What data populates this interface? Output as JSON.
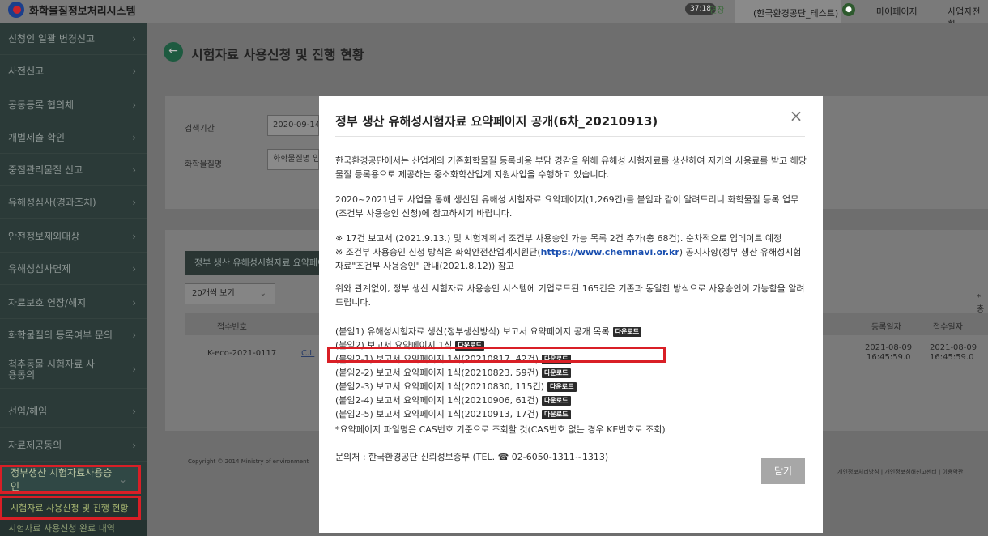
{
  "header": {
    "logo_text": "화학물질정보처리시스템",
    "timer": "37:18",
    "extend_label": "연장",
    "user_name": "(한국환경공단_테스트)",
    "mypage": "마이페이지",
    "company_link": "사업자전환"
  },
  "sidebar": {
    "items": [
      {
        "label": "신청인 일괄 변경신고"
      },
      {
        "label": "사전신고"
      },
      {
        "label": "공동등록 협의체"
      },
      {
        "label": "개별제출 확인"
      },
      {
        "label": "중점관리물질 신고"
      },
      {
        "label": "유해성심사(경과조치)"
      },
      {
        "label": "안전정보제외대상"
      },
      {
        "label": "유해성심사면제"
      },
      {
        "label": "자료보호 연장/해지"
      },
      {
        "label": "화학물질의 등록여부 문의"
      },
      {
        "label": "척추동물 시험자료 사용동의"
      },
      {
        "label": "선임/해임"
      },
      {
        "label": "자료제공동의"
      },
      {
        "label": "정부생산 시험자료사용승인"
      }
    ],
    "sub_items": [
      {
        "label": "시험자료 사용신청 및 진행 현황"
      },
      {
        "label": "시험자료 사용신청 완료 내역"
      }
    ],
    "toggle_icon": "‹"
  },
  "main": {
    "page_title": "시험자료 사용신청 및 진행 현황",
    "back_icon": "←",
    "search": {
      "period_label": "검색기간",
      "period_value": "2020-09-14",
      "chem_label": "화학물질명",
      "chem_placeholder": "화학물질명 입력"
    },
    "tab_label": "정부 생산 유해성시험자료 요약페이지 공개",
    "page_size": "20개씩 보기",
    "total_mark": "* 총",
    "table": {
      "headers": [
        "접수번호",
        "등록일자",
        "접수일자"
      ],
      "row": {
        "receipt_no": "K-eco-2021-0117",
        "link_text": "C.I.",
        "reg_date": "2021-08-09",
        "reg_time": "16:45:59.0",
        "rcpt_date": "2021-08-09",
        "rcpt_time": "16:45:59.0"
      }
    },
    "footer_copy": "Copyright © 2014 Ministry of environment",
    "footer_links": "개인정보처리방침 | 개인정보침해신고센터 | 이용약관"
  },
  "modal": {
    "title": "정부 생산 유해성시험자료 요약페이지 공개(6차_20210913)",
    "close_icon": "×",
    "para1": "한국환경공단에서는 산업계의 기존화학물질 등록비용 부담 경감을 위해 유해성 시험자료를 생산하여 저가의 사용료를 받고 해당 물질 등록용으로 제공하는 중소화학산업계 지원사업을 수행하고 있습니다.",
    "para2": "2020~2021년도 사업을 통해 생산된 유해성 시험자료 요약페이지(1,269건)를 붙임과 같이 알려드리니 화학물질 등록 업무(조건부 사용승인 신청)에 참고하시기 바랍니다.",
    "para3_line1": "※ 17건 보고서 (2021.9.13.) 및 시험계획서 조건부 사용승인 가능 목록 2건 추가(총 68건). 순차적으로 업데이트 예정",
    "para3_line2_pre": "※ 조건부 사용승인 신청 방식은 화학안전산업계지원단(",
    "para3_url": "https://www.chemnavi.or.kr",
    "para3_line2_post": ") 공지사항(정부 생산 유해성시험자료\"조건부 사용승인\" 안내(2021.8.12)) 참고",
    "para4": "위와 관계없이, 정부 생산 시험자료 사용승인 시스템에 기업로드된 165건은 기존과 동일한 방식으로 사용승인이 가능함을 알려드립니다.",
    "download_label": "다운로드",
    "attachments": [
      {
        "label": "(붙임1) 유해성시험자료 생산(정부생산방식) 보고서 요약페이지 공개 목록"
      },
      {
        "label": "(붙임2) 보고서 요약페이지 1식"
      },
      {
        "label": "(붙임2-1) 보고서 요약페이지 1식(20210817, 42건)"
      },
      {
        "label": "(붙임2-2) 보고서 요약페이지 1식(20210823, 59건)"
      },
      {
        "label": "(붙임2-3) 보고서 요약페이지 1식(20210830, 115건)"
      },
      {
        "label": "(붙임2-4) 보고서 요약페이지 1식(20210906, 61건)"
      },
      {
        "label": "(붙임2-5) 보고서 요약페이지 1식(20210913, 17건)"
      }
    ],
    "cas_note": "*요약페이지 파일명은 CAS번호 기준으로 조회할 것(CAS번호 없는 경우 KE번호로 조회)",
    "contact": "문의처 : 한국환경공단 신뢰성보증부 (TEL. ☎ 02-6050-1311~1313)",
    "confirm_label": "닫기"
  }
}
